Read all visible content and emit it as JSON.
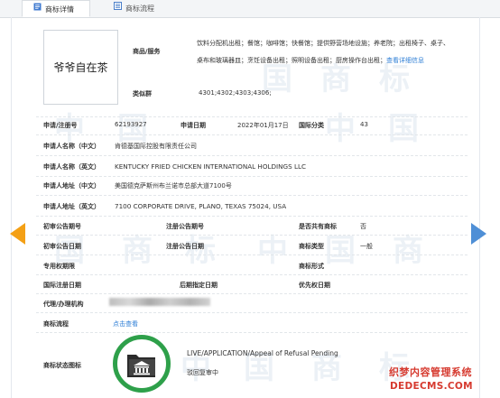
{
  "tabs": [
    {
      "label": "商标详情",
      "active": true
    },
    {
      "label": "商标流程",
      "active": false
    }
  ],
  "logo_text": "爷爷自在茶",
  "goods_services": {
    "label": "商品/服务",
    "line1": "饮料分配机出租；餐馆；咖啡馆；快餐馆；提供野营场地设施；养老院；出租椅子、桌子、",
    "line2": "桌布和玻璃器皿；烹饪设备出租；照明设备出租；厨房操作台出租；",
    "link": "查看详细信息"
  },
  "similar_group": {
    "label": "类似群",
    "value": "4301;4302;4303;4306;"
  },
  "rows": {
    "reg_no_label": "申请/注册号",
    "reg_no": "62193927",
    "app_date_label": "申请日期",
    "app_date": "2022年01月17日",
    "intl_class_label": "国际分类",
    "intl_class": "43",
    "applicant_cn_label": "申请人名称（中文）",
    "applicant_cn": "肯德基国际控股有限责任公司",
    "applicant_en_label": "申请人名称（英文）",
    "applicant_en": "KENTUCKY FRIED CHICKEN INTERNATIONAL HOLDINGS LLC",
    "address_cn_label": "申请人地址（中文）",
    "address_cn": "美国德克萨斯州布兰诺市总部大道7100号",
    "address_en_label": "申请人地址（英文）",
    "address_en": "7100 CORPORATE DRIVE, PLANO, TEXAS 75024, USA",
    "prelim_pub_no_label": "初审公告期号",
    "prelim_pub_no": "",
    "reg_pub_no_label": "注册公告期号",
    "reg_pub_no": "",
    "shared_label": "是否共有商标",
    "shared": "否",
    "prelim_pub_date_label": "初审公告日期",
    "prelim_pub_date": "",
    "reg_pub_date_label": "注册公告日期",
    "reg_pub_date": "",
    "tm_type_label": "商标类型",
    "tm_type": "一般",
    "exclusive_period_label": "专用权期限",
    "exclusive_period": "",
    "tm_form_label": "商标形式",
    "tm_form": "",
    "intl_reg_date_label": "国际注册日期",
    "intl_reg_date": "",
    "later_date_label": "后期指定日期",
    "later_date": "",
    "priority_date_label": "优先权日期",
    "priority_date": "",
    "agent_label": "代理/办理机构",
    "agent": "",
    "flow_label": "商标流程",
    "flow_link": "点击查看",
    "status_label": "商标状态图标",
    "status_en": "LIVE/APPLICATION/Appeal of Refusal Pending",
    "status_cn": "驳回复审中"
  },
  "site_watermark": {
    "line1": "织梦内容管理系统",
    "line2": "DEDECMS.COM"
  },
  "colors": {
    "arrow_left": "#f4a015",
    "arrow_right": "#4f8fd6",
    "seal": "#2ea04a",
    "link": "#2f7fd6"
  }
}
